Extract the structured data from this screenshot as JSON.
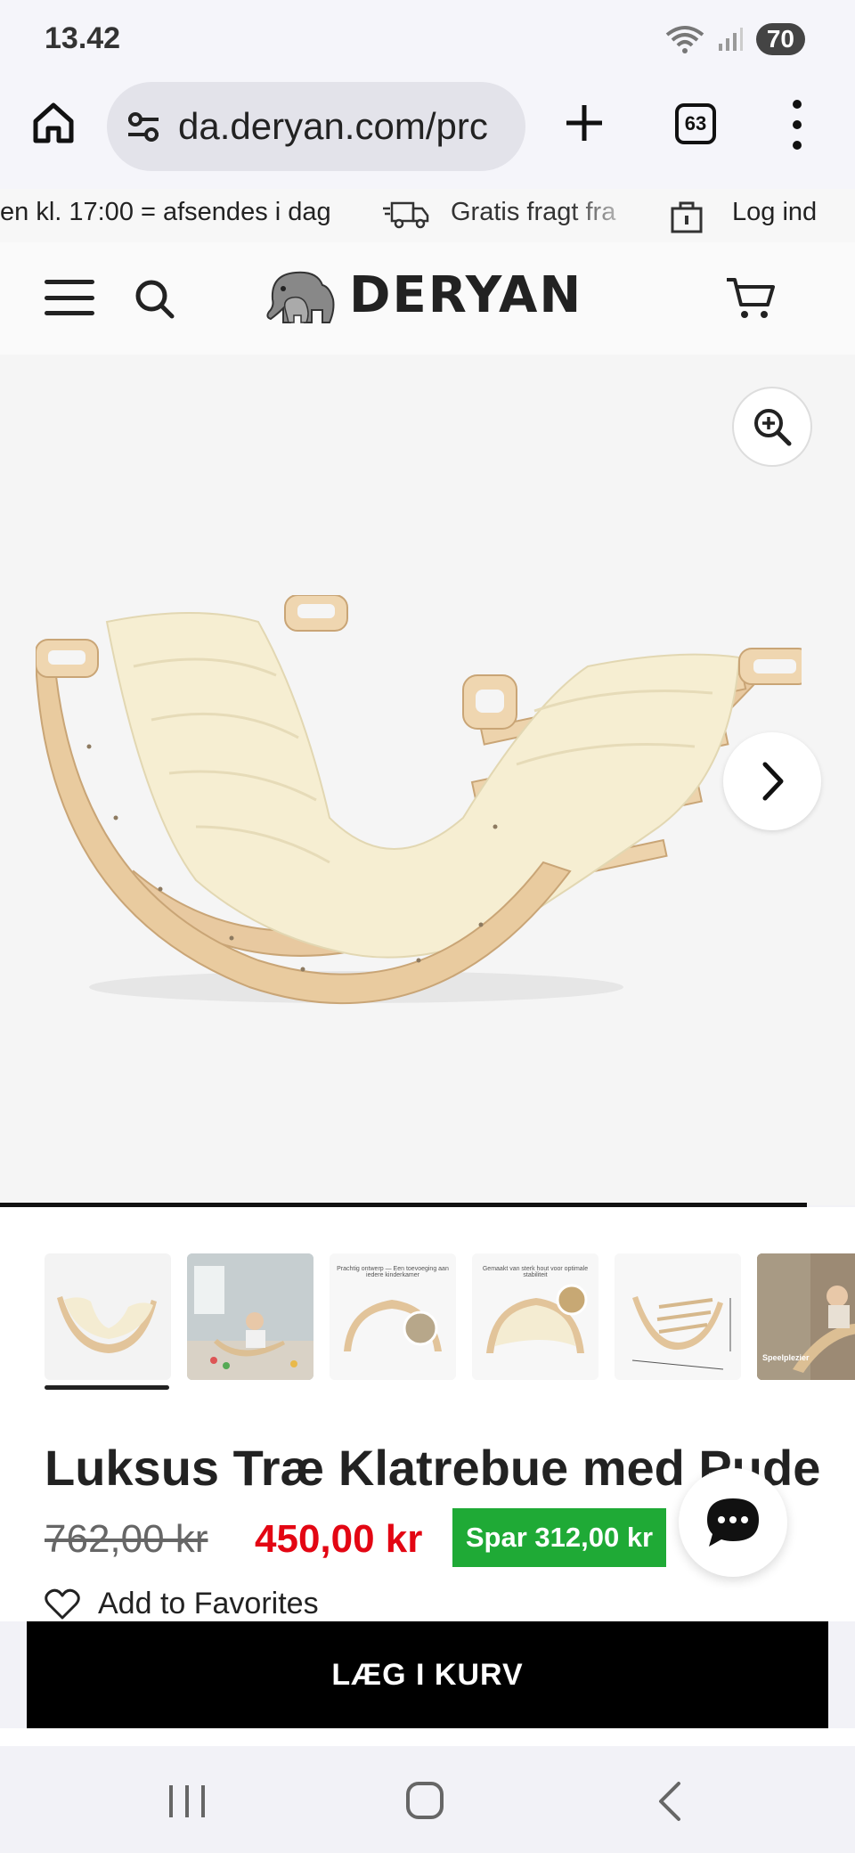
{
  "status_bar": {
    "time": "13.42",
    "battery": "70"
  },
  "browser": {
    "url": "da.deryan.com/prc",
    "tab_count": "63"
  },
  "announcement": {
    "items": [
      "en kl. 17:00 = afsendes i dag",
      "Gratis fragt fra",
      "Log ind"
    ]
  },
  "header": {
    "brand": "DERYAN"
  },
  "product": {
    "title": "Luksus Træ Klatrebue med Pude",
    "old_price": "762,00 kr",
    "new_price": "450,00 kr",
    "save_label": "Spar 312,00 kr",
    "favorites_label": "Add to Favorites",
    "add_to_cart": "LÆG I KURV"
  },
  "thumbnails": {
    "captions": [
      "",
      "",
      "Prachtig ontwerp — Een toevoeging aan iedere kinderkamer",
      "Gemaakt van sterk hout voor optimale stabiliteit",
      "",
      "Speelplezier"
    ]
  },
  "colors": {
    "price_red": "#e30613",
    "save_green": "#1faa36",
    "cta_black": "#000000"
  },
  "icons": {
    "home": "home-icon",
    "tune": "site-settings-icon",
    "plus": "new-tab-icon",
    "tabs": "tabs-icon",
    "menu": "more-vert-icon",
    "truck": "truck-icon",
    "lock": "lock-icon",
    "hamburger": "hamburger-icon",
    "search": "search-icon",
    "cart": "cart-icon",
    "zoom": "zoom-in-icon",
    "next": "chevron-right-icon",
    "heart": "heart-icon",
    "chat": "chat-icon"
  }
}
